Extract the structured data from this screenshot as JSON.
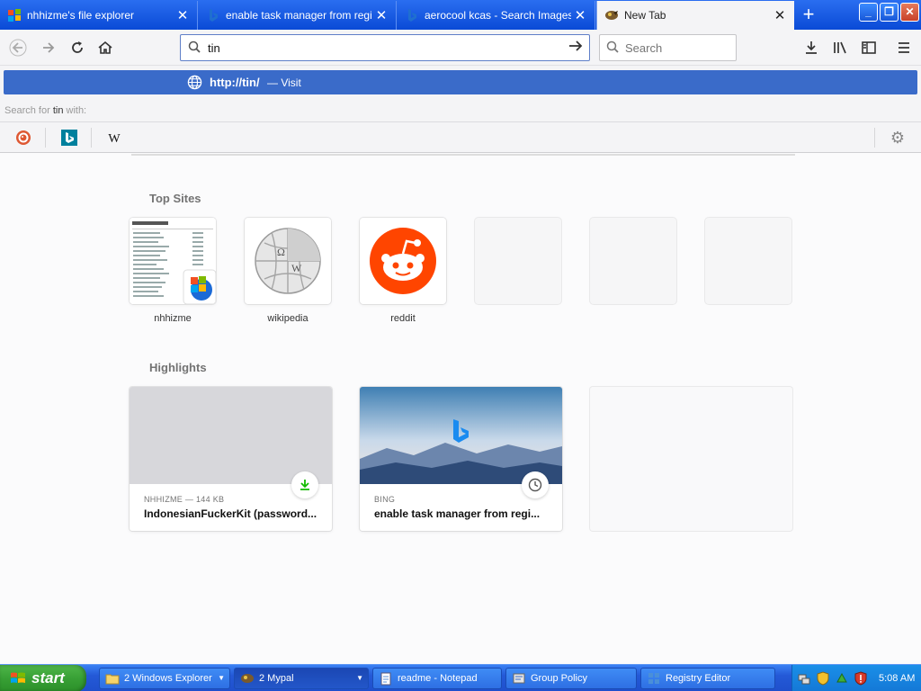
{
  "tabs": [
    {
      "title": "nhhizme's file explorer",
      "active": false
    },
    {
      "title": "enable task manager from registr",
      "active": false
    },
    {
      "title": "aerocool kcas - Search Images",
      "active": false
    },
    {
      "title": "New Tab",
      "active": true
    }
  ],
  "nav": {
    "url_value": "tin",
    "search_placeholder": "Search"
  },
  "dropdown": {
    "suggestion_url": "http://tin/",
    "suggestion_action": "— Visit",
    "search_for_prefix": "Search for",
    "search_for_term": "tin",
    "search_for_suffix": "with:",
    "engines": [
      "duckduckgo",
      "bing",
      "wikipedia"
    ]
  },
  "top_sites": {
    "title": "Top Sites",
    "items": [
      {
        "label": "nhhizme"
      },
      {
        "label": "wikipedia"
      },
      {
        "label": "reddit"
      },
      {
        "label": ""
      },
      {
        "label": ""
      },
      {
        "label": ""
      }
    ]
  },
  "highlights": {
    "title": "Highlights",
    "cards": [
      {
        "context": "NHHIZME — 144 KB",
        "title": "IndonesianFuckerKit (password...",
        "badge": "download-icon"
      },
      {
        "context": "BING",
        "title": "enable task manager from regi...",
        "badge": "clock-icon"
      }
    ]
  },
  "taskbar": {
    "start_label": "start",
    "tasks": [
      {
        "label": "2 Windows Explorer",
        "group": true
      },
      {
        "label": "2 Mypal",
        "group": true
      },
      {
        "label": "readme - Notepad",
        "group": false
      },
      {
        "label": "Group Policy",
        "group": false
      },
      {
        "label": "Registry Editor",
        "group": false
      }
    ],
    "clock": "5:08 AM"
  },
  "colors": {
    "accent_blue": "#3a6bc9",
    "titlebar_blue": "#0a4ad6",
    "reddit_orange": "#ff4500",
    "download_green": "#12bc00"
  }
}
